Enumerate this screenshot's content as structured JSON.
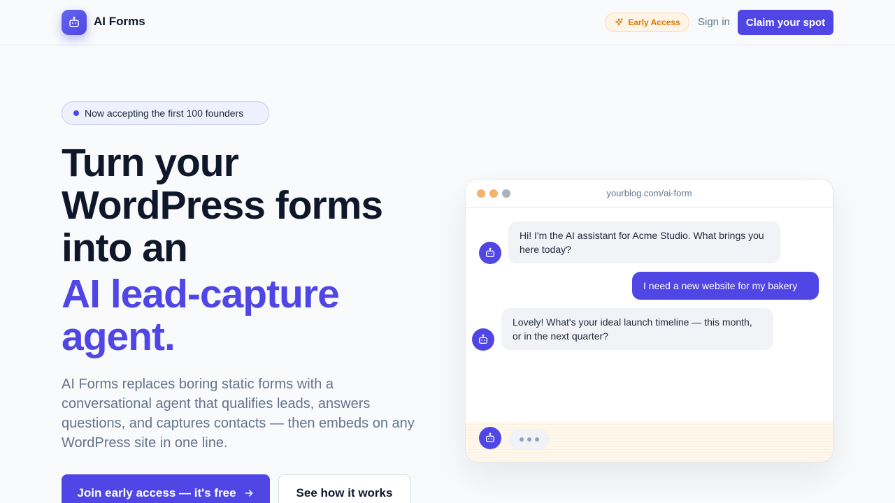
{
  "nav": {
    "brand": "AI Forms",
    "early_access": "Early Access",
    "sign_in": "Sign in",
    "claim": "Claim your spot"
  },
  "hero": {
    "pill": "Now accepting the first 100 founders",
    "headline_lines": [
      "Turn your",
      "WordPress forms",
      "into an"
    ],
    "accent_lines": [
      "AI lead-capture",
      "agent."
    ],
    "subtext": "AI Forms replaces boring static forms with a conversational agent that qualifies leads, answers questions, and captures contacts — then embeds on any WordPress site in one line.",
    "cta_primary": "Join early access — it's free",
    "cta_secondary": "See how it works"
  },
  "mock": {
    "url": "yourblog.com/ai-form",
    "messages": [
      {
        "from": "bot",
        "text": "Hi!    I'm the AI assistant for Acme Studio. What brings you here today?"
      },
      {
        "from": "user",
        "text": "I need a new website for my bakery"
      },
      {
        "from": "bot",
        "text": "Lovely! What's your ideal launch timeline — this month, or in the next quarter?"
      }
    ]
  },
  "colors": {
    "accent": "#4f46e5",
    "amber": "#d97706",
    "text_dark": "#0f172a",
    "text_muted": "#64748b"
  },
  "icons": {
    "logo": "robot-icon",
    "early_access": "sparkle-icon",
    "cta_primary": "arrow-right-icon",
    "bot_avatar": "robot-icon"
  }
}
